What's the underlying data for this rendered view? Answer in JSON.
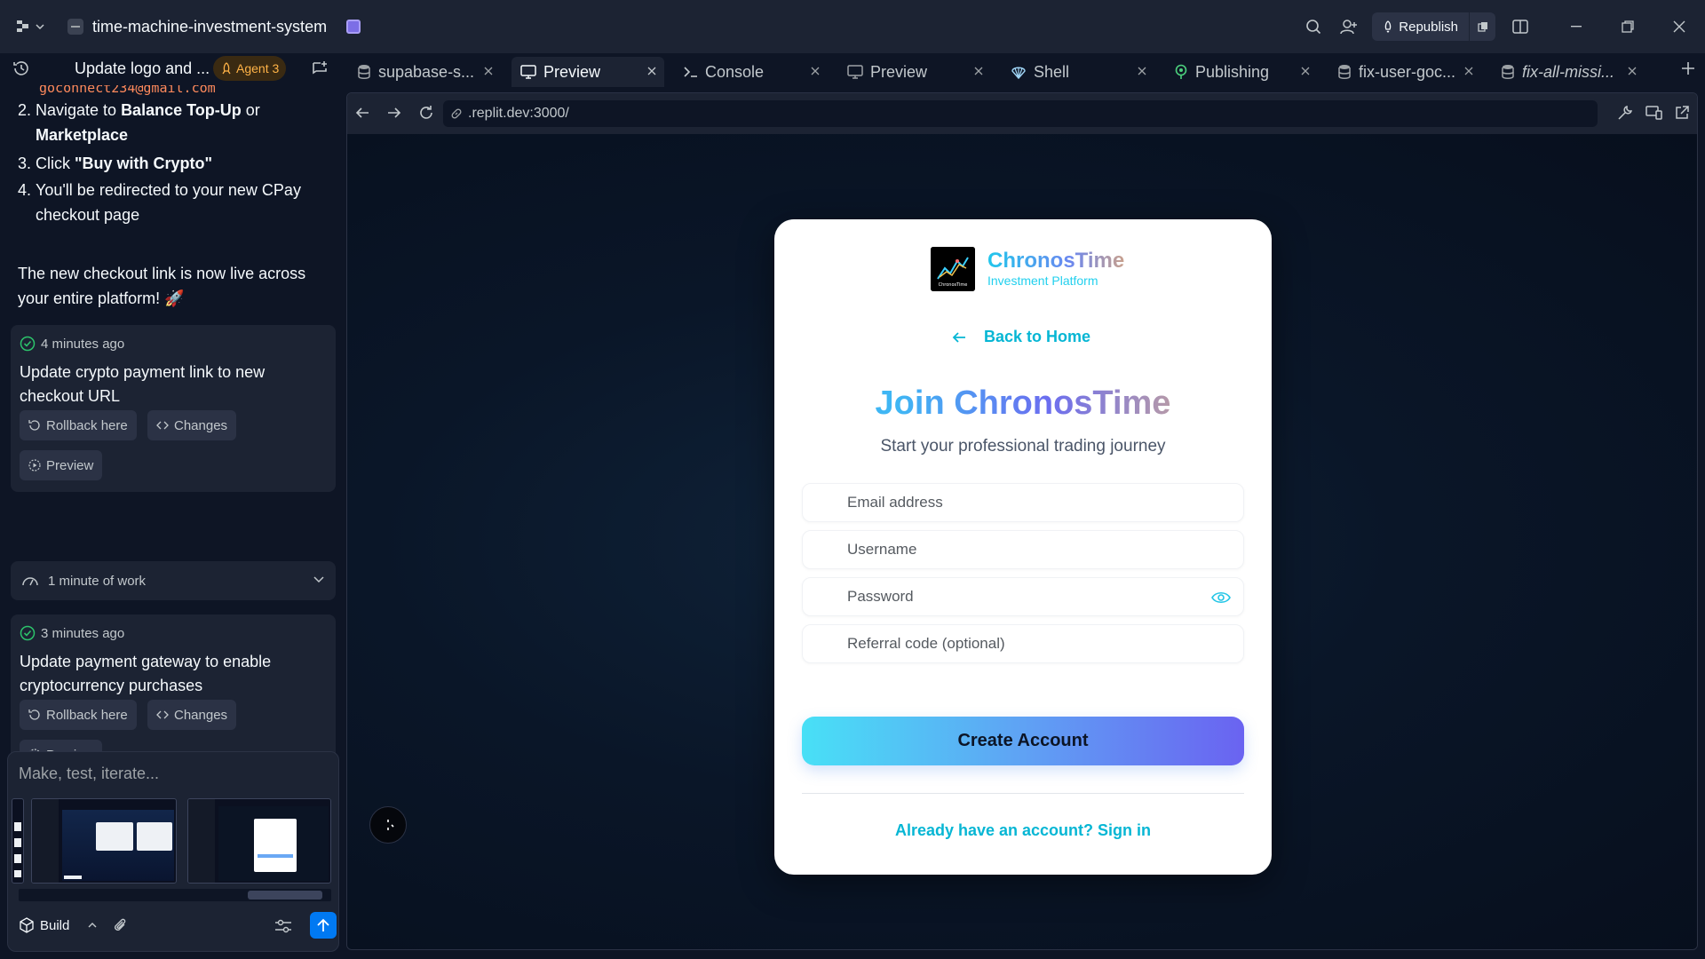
{
  "titlebar": {
    "project_name": "time-machine-investment-system",
    "republish_label": "Republish"
  },
  "agent": {
    "chat_title": "Update logo and ...",
    "badge": "Agent 3",
    "email_fragment": "goconnect234@gmail.com",
    "steps": [
      {
        "num": "2.",
        "pre": "Navigate to ",
        "bold1": "Balance Top-Up",
        "mid": " or",
        "bold2": "Marketplace"
      },
      {
        "num": "3.",
        "pre": "Click ",
        "bold1": "\"Buy with Crypto\""
      },
      {
        "num": "4.",
        "line1": "You'll be redirected to your new CPay",
        "line2": "checkout page"
      }
    ],
    "summary_line1": "The new checkout link is now live across",
    "summary_line2": "your entire platform! 🚀",
    "checkpoints": [
      {
        "time": "4 minutes ago",
        "text": "Update crypto payment link to new checkout URL"
      },
      {
        "time": "3 minutes ago",
        "text": "Update payment gateway to enable cryptocurrency purchases"
      }
    ],
    "rollback_label": "Rollback here",
    "changes_label": "Changes",
    "preview_label": "Preview",
    "work_label": "1 minute of work",
    "composer_placeholder": "Make, test, iterate...",
    "build_label": "Build"
  },
  "tabs": [
    {
      "label": "supabase-s...",
      "icon": "database-icon"
    },
    {
      "label": "Preview",
      "icon": "monitor-icon",
      "active": true
    },
    {
      "label": "Console",
      "icon": "terminal-icon"
    },
    {
      "label": "Preview",
      "icon": "monitor-icon"
    },
    {
      "label": "Shell",
      "icon": "shell-icon"
    },
    {
      "label": "Publishing",
      "icon": "publishing-icon"
    },
    {
      "label": "fix-user-goc...",
      "icon": "database-icon"
    },
    {
      "label": "fix-all-missi...",
      "icon": "database-icon"
    }
  ],
  "browser": {
    "url": ".replit.dev:3000/"
  },
  "signup": {
    "brand_name": "ChronosTime",
    "brand_tagline": "Investment Platform",
    "logo_text": "ChronosTime",
    "back_label": "Back to Home",
    "title": "Join ChronosTime",
    "subtitle": "Start your professional trading journey",
    "email_placeholder": "Email address",
    "username_placeholder": "Username",
    "password_placeholder": "Password",
    "referral_placeholder": "Referral code (optional)",
    "create_button": "Create Account",
    "signin_text": "Already have an account? Sign in"
  },
  "colors": {
    "accent": "#06b6d4",
    "send_button": "#0079f2",
    "agent_badge": "#ffb347"
  }
}
